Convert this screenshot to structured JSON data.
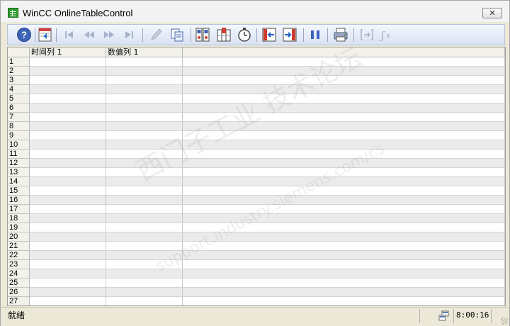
{
  "window": {
    "title": "WinCC OnlineTableControl",
    "close_label": "✕"
  },
  "toolbar": {
    "buttons": [
      {
        "name": "help-icon",
        "enabled": true
      },
      {
        "name": "config-dialog-icon",
        "enabled": true
      },
      {
        "name": "first-record-icon",
        "enabled": false
      },
      {
        "name": "previous-record-icon",
        "enabled": false
      },
      {
        "name": "next-record-icon",
        "enabled": false
      },
      {
        "name": "last-record-icon",
        "enabled": false
      },
      {
        "name": "edit-icon",
        "enabled": false
      },
      {
        "name": "copy-rows-icon",
        "enabled": true
      },
      {
        "name": "select-archive-tag-icon",
        "enabled": true
      },
      {
        "name": "select-columns-icon",
        "enabled": true
      },
      {
        "name": "select-time-range-icon",
        "enabled": true
      },
      {
        "name": "previous-column-icon",
        "enabled": true
      },
      {
        "name": "next-column-icon",
        "enabled": true
      },
      {
        "name": "stop-icon",
        "enabled": true
      },
      {
        "name": "print-icon",
        "enabled": true
      },
      {
        "name": "define-statistics-area-icon",
        "enabled": false
      },
      {
        "name": "calculate-statistics-icon",
        "enabled": false
      }
    ]
  },
  "table": {
    "columns": [
      "时间列 1",
      "数值列 1"
    ],
    "row_numbers": [
      "1",
      "2",
      "3",
      "4",
      "5",
      "6",
      "7",
      "8",
      "9",
      "10",
      "11",
      "12",
      "13",
      "14",
      "15",
      "16",
      "17",
      "18",
      "19",
      "20",
      "21",
      "22",
      "23",
      "24",
      "25",
      "26",
      "27"
    ]
  },
  "watermark": {
    "line1": "西门子工业 技术论坛",
    "line2": "support.industry.siemens.com/cs"
  },
  "status": {
    "text": "就绪",
    "time": "8:00:16"
  },
  "colors": {
    "toolbar_bg": "#dfe6f4",
    "grid_alt_row": "#ebebeb",
    "window_bg": "#ece9d8"
  }
}
